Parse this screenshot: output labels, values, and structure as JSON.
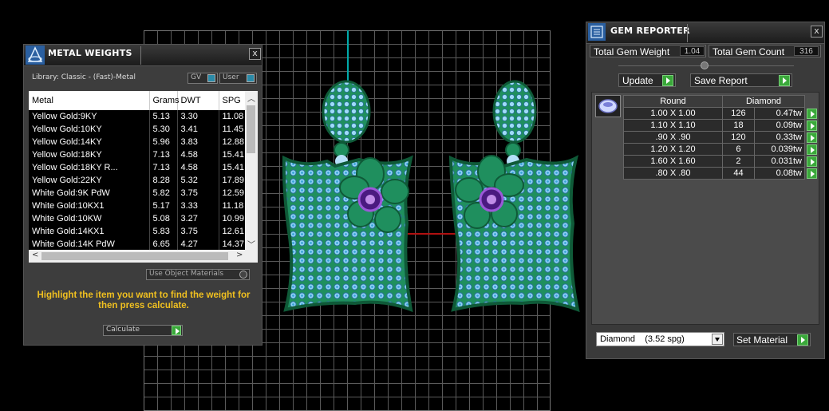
{
  "metal_weights": {
    "title": "METAL WEIGHTS",
    "close": "x",
    "library": "Library: Classic - (Fast)-Metal",
    "toggle_gv": "GV",
    "toggle_user": "User",
    "columns": [
      "Metal",
      "Grams",
      "DWT",
      "SPG"
    ],
    "rows": [
      [
        "Yellow Gold:9KY",
        "5.13",
        "3.30",
        "11.08"
      ],
      [
        "Yellow Gold:10KY",
        "5.30",
        "3.41",
        "11.45"
      ],
      [
        "Yellow Gold:14KY",
        "5.96",
        "3.83",
        "12.88"
      ],
      [
        "Yellow Gold:18KY",
        "7.13",
        "4.58",
        "15.41"
      ],
      [
        "Yellow Gold:18KY R...",
        "7.13",
        "4.58",
        "15.41"
      ],
      [
        "Yellow Gold:22KY",
        "8.28",
        "5.32",
        "17.89"
      ],
      [
        "White Gold:9K PdW",
        "5.82",
        "3.75",
        "12.59"
      ],
      [
        "White Gold:10KX1",
        "5.17",
        "3.33",
        "11.18"
      ],
      [
        "White Gold:10KW",
        "5.08",
        "3.27",
        "10.99"
      ],
      [
        "White Gold:14KX1",
        "5.83",
        "3.75",
        "12.61"
      ],
      [
        "White Gold:14K PdW",
        "6.65",
        "4.27",
        "14.37"
      ]
    ],
    "use_object_materials": "Use Object Materials",
    "hint": "Highlight the item you want to find the weight for then press calculate.",
    "calculate": "Calculate"
  },
  "gem_reporter": {
    "title": "GEM REPORTER",
    "close": "x",
    "total_weight_label": "Total Gem Weight",
    "total_weight_value": "1.04",
    "total_count_label": "Total Gem Count",
    "total_count_value": "316",
    "update": "Update",
    "save_report": "Save Report",
    "header_shape": "Round",
    "header_material": "Diamond",
    "rows": [
      [
        "1.00 X 1.00",
        "126",
        "0.47tw"
      ],
      [
        "1.10 X 1.10",
        "18",
        "0.09tw"
      ],
      [
        ".90 X .90",
        "120",
        "0.33tw"
      ],
      [
        "1.20 X 1.20",
        "6",
        "0.039tw"
      ],
      [
        "1.60 X 1.60",
        "2",
        "0.031tw"
      ],
      [
        ".80 X .80",
        "44",
        "0.08tw"
      ]
    ],
    "material_select": "Diamond    (3.52 spg)",
    "set_material": "Set Material"
  },
  "colors": {
    "metal": "#1f8f5e",
    "gem": "#7fc8f0",
    "center_stone": "#7a2db0",
    "hint": "#f0c020",
    "accent_button": "#3aa83a"
  }
}
